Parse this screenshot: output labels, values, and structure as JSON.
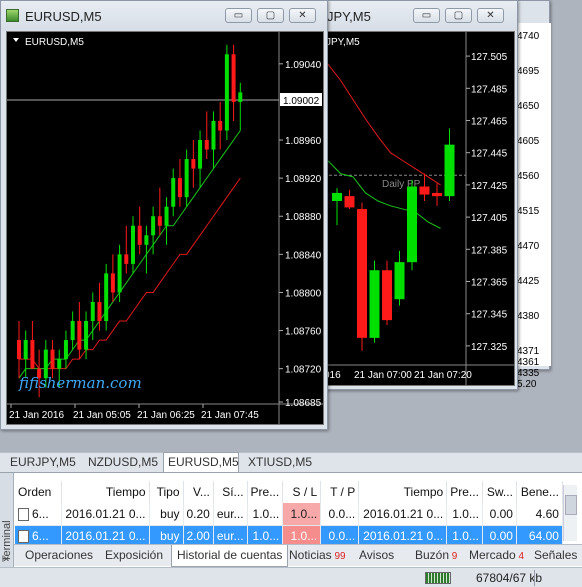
{
  "windows": {
    "eurusd": {
      "title": "EURUSD,M5",
      "chart_label": "EURUSD,M5",
      "price_levels": [
        "1.09040",
        "1.09002",
        "1.08960",
        "1.08920",
        "1.08880",
        "1.08840",
        "1.08800",
        "1.08760",
        "1.08720",
        "1.08685"
      ],
      "current_price": "1.09002",
      "time_labels": [
        "21 Jan 2016",
        "21 Jan 05:05",
        "21 Jan 06:25",
        "21 Jan 07:45"
      ],
      "watermark": "fifisherman.com"
    },
    "eurjpy": {
      "title": "JPY,M5",
      "chart_label": "JPY,M5",
      "price_levels": [
        "127.505",
        "127.485",
        "127.465",
        "127.445",
        "127.425",
        "127.405",
        "127.385",
        "127.365",
        "127.345",
        "127.325"
      ],
      "time_labels": [
        "016",
        "21 Jan 07:00",
        "21 Jan 07:20"
      ],
      "pivot_label": "Daily PP"
    },
    "third": {
      "price_levels": [
        "4740",
        "4695",
        "4650",
        "4605",
        "4560",
        "4515",
        "4470",
        "4425",
        "4380",
        "4371",
        "4361",
        "4335",
        "5.20"
      ]
    }
  },
  "window_buttons": {
    "minimize": "▭",
    "maximize": "▢",
    "close": "✕"
  },
  "chart_tabs": [
    "EURJPY,M5",
    "NZDUSD,M5",
    "EURUSD,M5",
    "XTIUSD,M5"
  ],
  "active_chart_tab": "EURUSD,M5",
  "terminal": {
    "side_label": "Terminal",
    "close_glyph": "×",
    "columns": [
      "Orden",
      "Tiempo",
      "Tipo",
      "V...",
      "Sí...",
      "Pre...",
      "S / L",
      "T / P",
      "Tiempo",
      "Pre...",
      "Sw...",
      "Bene..."
    ],
    "rows": [
      [
        "6...",
        "2016.01.21 0...",
        "buy",
        "0.20",
        "eur...",
        "1.0...",
        "1.0...",
        "0.0...",
        "2016.01.21 0...",
        "1.0...",
        "0.00",
        "4.60"
      ],
      [
        "6...",
        "2016.01.21 0...",
        "buy",
        "2.00",
        "eur...",
        "1.0...",
        "1.0...",
        "0.0...",
        "2016.01.21 0...",
        "1.0...",
        "0.00",
        "64.00"
      ]
    ],
    "tabs": [
      {
        "label": "Operaciones",
        "count": ""
      },
      {
        "label": "Exposición",
        "count": ""
      },
      {
        "label": "Historial de cuentas",
        "count": ""
      },
      {
        "label": "Noticias",
        "count": "99"
      },
      {
        "label": "Avisos",
        "count": ""
      },
      {
        "label": "Buzón",
        "count": "9"
      },
      {
        "label": "Mercado",
        "count": "4"
      },
      {
        "label": "Señales",
        "count": ""
      }
    ],
    "active_tab": "Historial de cuentas"
  },
  "status_bar": {
    "memory": "67804/67 kb"
  },
  "colors": {
    "bull": "#00e000",
    "bear": "#ff1a1a",
    "ma_fast": "#19c419",
    "ma_slow": "#e01a1a",
    "selected_row": "#3399ff"
  },
  "chart_data": [
    {
      "type": "candlestick",
      "symbol": "EURUSD",
      "timeframe": "M5",
      "ylim": [
        1.08685,
        1.09065
      ],
      "x_ticks": [
        "21 Jan 2016",
        "21 Jan 05:05",
        "21 Jan 06:25",
        "21 Jan 07:45"
      ],
      "candles": [
        [
          1.0875,
          1.0877,
          1.0871,
          1.0873
        ],
        [
          1.0873,
          1.0876,
          1.0871,
          1.0875
        ],
        [
          1.0875,
          1.0877,
          1.0872,
          1.0872
        ],
        [
          1.0872,
          1.0874,
          1.0869,
          1.0871
        ],
        [
          1.0871,
          1.0875,
          1.087,
          1.0874
        ],
        [
          1.0874,
          1.0875,
          1.0871,
          1.0872
        ],
        [
          1.0872,
          1.0874,
          1.087,
          1.0873
        ],
        [
          1.0873,
          1.0876,
          1.0872,
          1.0875
        ],
        [
          1.0875,
          1.0878,
          1.0874,
          1.0877
        ],
        [
          1.0877,
          1.0879,
          1.0873,
          1.0874
        ],
        [
          1.0874,
          1.0878,
          1.0873,
          1.0877
        ],
        [
          1.0877,
          1.088,
          1.0875,
          1.0879
        ],
        [
          1.0879,
          1.0881,
          1.0876,
          1.0877
        ],
        [
          1.0877,
          1.0883,
          1.0876,
          1.0882
        ],
        [
          1.0882,
          1.0884,
          1.0879,
          1.088
        ],
        [
          1.088,
          1.0885,
          1.0879,
          1.0884
        ],
        [
          1.0884,
          1.0887,
          1.0882,
          1.0883
        ],
        [
          1.0883,
          1.0888,
          1.0882,
          1.0887
        ],
        [
          1.0887,
          1.0889,
          1.0884,
          1.0885
        ],
        [
          1.0885,
          1.0887,
          1.0882,
          1.0886
        ],
        [
          1.0886,
          1.0889,
          1.0884,
          1.0888
        ],
        [
          1.0888,
          1.0891,
          1.0886,
          1.0887
        ],
        [
          1.0887,
          1.089,
          1.0885,
          1.0889
        ],
        [
          1.0889,
          1.0893,
          1.0888,
          1.0892
        ],
        [
          1.0892,
          1.0894,
          1.0889,
          1.089
        ],
        [
          1.089,
          1.0895,
          1.0889,
          1.0894
        ],
        [
          1.0894,
          1.0896,
          1.0891,
          1.0893
        ],
        [
          1.0893,
          1.0897,
          1.0891,
          1.0896
        ],
        [
          1.0896,
          1.0899,
          1.0894,
          1.0895
        ],
        [
          1.0895,
          1.0899,
          1.0893,
          1.0898
        ],
        [
          1.0898,
          1.09,
          1.0895,
          1.0897
        ],
        [
          1.0897,
          1.0906,
          1.0896,
          1.0905
        ],
        [
          1.0905,
          1.0906,
          1.0898,
          1.09
        ],
        [
          1.09,
          1.0902,
          1.0897,
          1.0901
        ]
      ],
      "ma_fast": [
        1.0871,
        1.0872,
        1.0872,
        1.0872,
        1.0872,
        1.0873,
        1.0873,
        1.0873,
        1.0874,
        1.0875,
        1.0875,
        1.0876,
        1.0877,
        1.0878,
        1.0879,
        1.088,
        1.0881,
        1.0882,
        1.0883,
        1.0884,
        1.0885,
        1.0886,
        1.0887,
        1.0887,
        1.0888,
        1.0889,
        1.089,
        1.0891,
        1.0892,
        1.0893,
        1.0894,
        1.0895,
        1.0896,
        1.0897
      ],
      "ma_slow": [
        1.0873,
        1.0873,
        1.0873,
        1.0872,
        1.0872,
        1.0872,
        1.0872,
        1.0872,
        1.0873,
        1.0873,
        1.0874,
        1.0874,
        1.0875,
        1.0875,
        1.0876,
        1.0877,
        1.0877,
        1.0878,
        1.0879,
        1.088,
        1.088,
        1.0881,
        1.0882,
        1.0883,
        1.0884,
        1.0884,
        1.0885,
        1.0886,
        1.0887,
        1.0888,
        1.0889,
        1.089,
        1.0891,
        1.0892
      ]
    },
    {
      "type": "candlestick",
      "symbol": "EURJPY",
      "timeframe": "M5",
      "ylim": [
        127.315,
        127.515
      ],
      "x_ticks": [
        "016",
        "21 Jan 07:00",
        "21 Jan 07:20"
      ],
      "pivot": 127.431,
      "candles": [
        [
          127.415,
          127.423,
          127.4,
          127.42
        ],
        [
          127.418,
          127.422,
          127.41,
          127.411
        ],
        [
          127.41,
          127.414,
          127.322,
          127.33
        ],
        [
          127.33,
          127.378,
          127.327,
          127.372
        ],
        [
          127.372,
          127.378,
          127.338,
          127.341
        ],
        [
          127.354,
          127.384,
          127.35,
          127.377
        ],
        [
          127.377,
          127.428,
          127.372,
          127.424
        ],
        [
          127.424,
          127.432,
          127.415,
          127.419
        ],
        [
          127.42,
          127.426,
          127.412,
          127.418
        ],
        [
          127.418,
          127.46,
          127.415,
          127.45
        ]
      ],
      "ma_fast": [
        127.44,
        127.432,
        127.43,
        127.42,
        127.415,
        127.412,
        127.41,
        127.408,
        127.402,
        127.398
      ],
      "ma_slow": [
        127.5,
        127.49,
        127.478,
        127.466,
        127.455,
        127.445,
        127.44,
        127.435,
        127.43,
        127.425
      ]
    }
  ]
}
